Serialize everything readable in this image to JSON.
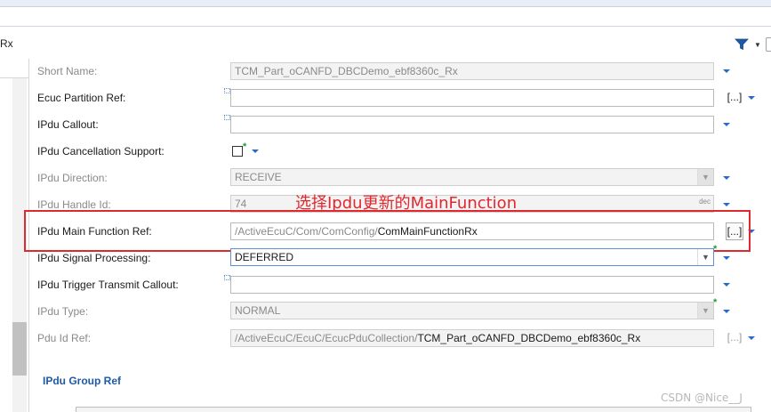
{
  "header": {
    "title_fragment": "Rx"
  },
  "fields": {
    "short_name": {
      "label": "Short Name:",
      "value": "TCM_Part_oCANFD_DBCDemo_ebf8360c_Rx"
    },
    "ecuc_partition_ref": {
      "label": "Ecuc Partition Ref:",
      "value": "",
      "browse": "[...]"
    },
    "ipdu_callout": {
      "label": "IPdu Callout:",
      "value": ""
    },
    "ipdu_cancellation_support": {
      "label": "IPdu Cancellation Support:",
      "checked": false
    },
    "ipdu_direction": {
      "label": "IPdu Direction:",
      "value": "RECEIVE"
    },
    "ipdu_handle_id": {
      "label": "IPdu Handle Id:",
      "value": "74",
      "format_tag": "dec"
    },
    "ipdu_main_function_ref": {
      "label": "IPdu Main Function Ref:",
      "path_prefix": "/ActiveEcuC/Com/ComConfig/",
      "path_name": "ComMainFunctionRx",
      "browse": "[...]"
    },
    "ipdu_signal_processing": {
      "label": "IPdu Signal Processing:",
      "value": "DEFERRED"
    },
    "ipdu_trigger_transmit_callout": {
      "label": "IPdu Trigger Transmit Callout:",
      "value": ""
    },
    "ipdu_type": {
      "label": "IPdu Type:",
      "value": "NORMAL"
    },
    "pdu_id_ref": {
      "label": "Pdu Id Ref:",
      "path_prefix": "/ActiveEcuC/EcuC/EcucPduCollection/",
      "path_name": "TCM_Part_oCANFD_DBCDemo_ebf8360c_Rx",
      "browse": "[...]"
    }
  },
  "section": {
    "ipdu_group_ref_title": "IPdu Group Ref"
  },
  "annotation": {
    "text": "选择Ipdu更新的MainFunction",
    "color": "#e0282e"
  },
  "watermark": "CSDN @Nice__J",
  "colors": {
    "accent_blue": "#2a69c9",
    "section_blue": "#1f5aa6",
    "highlight_red": "#e0282e",
    "required_green": "#1f9c3a"
  }
}
